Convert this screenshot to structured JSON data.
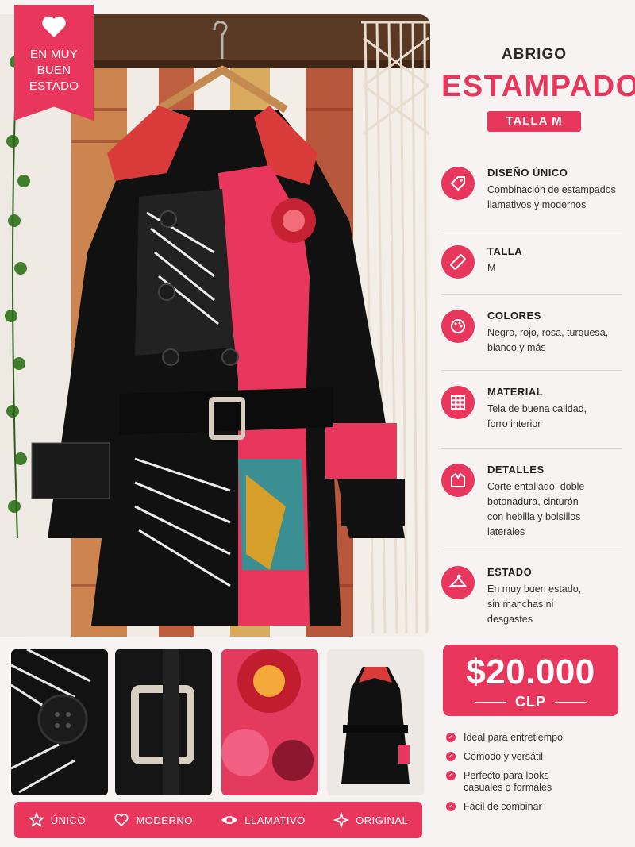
{
  "badge": {
    "text_line1": "EN MUY",
    "text_line2": "BUEN",
    "text_line3": "ESTADO"
  },
  "title": {
    "small": "ABRIGO",
    "big": "ESTAMPADO",
    "size_label": "TALLA M"
  },
  "features": [
    {
      "title": "DISEÑO ÚNICO",
      "line1": "Combinación de estampados",
      "line2": "llamativos y modernos",
      "icon": "tag-icon"
    },
    {
      "title": "TALLA",
      "line1": "M",
      "icon": "ruler-icon"
    },
    {
      "title": "COLORES",
      "line1": "Negro, rojo, rosa, turquesa,",
      "line2": "blanco y más",
      "icon": "palette-icon"
    },
    {
      "title": "MATERIAL",
      "line1": "Tela de buena calidad,",
      "line2": "forro interior",
      "icon": "fabric-grid-icon"
    },
    {
      "title": "DETALLES",
      "line1": "Corte entallado, doble",
      "line2": "botonadura, cinturón",
      "line3": "con hebilla y bolsillos",
      "line4": "laterales",
      "icon": "coat-icon"
    },
    {
      "title": "ESTADO",
      "line1": "En muy buen estado,",
      "line2": "sin manchas ni",
      "line3": "desgastes",
      "icon": "hanger-icon"
    }
  ],
  "price": {
    "amount": "$20.000",
    "currency": "CLP"
  },
  "bullets": [
    "Ideal para entretiempo",
    "Cómodo y versátil",
    "Perfecto para looks casuales o formales",
    "Fácil de combinar"
  ],
  "tags": [
    {
      "label": "ÚNICO",
      "icon": "star-icon"
    },
    {
      "label": "MODERNO",
      "icon": "heart-icon"
    },
    {
      "label": "LLAMATIVO",
      "icon": "eye-icon"
    },
    {
      "label": "ORIGINAL",
      "icon": "sparkle-icon"
    }
  ],
  "colors": {
    "accent": "#e8365d",
    "coat": "#111111"
  }
}
